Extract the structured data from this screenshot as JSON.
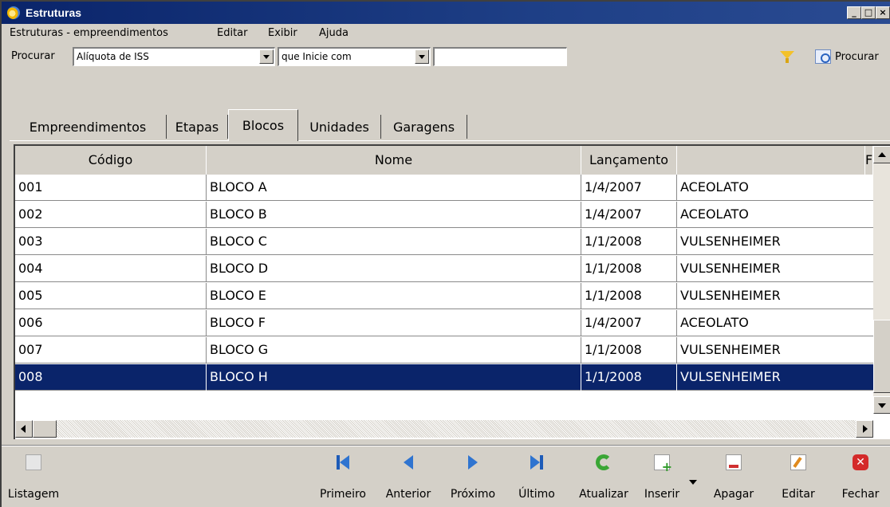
{
  "window": {
    "title": "Estruturas",
    "controls": [
      "_",
      "□",
      "×"
    ]
  },
  "menu": {
    "items": [
      "Estruturas - empreendimentos",
      "Editar",
      "Exibir",
      "Ajuda"
    ]
  },
  "search": {
    "label": "Procurar",
    "field_value": "Alíquota de ISS",
    "operator_value": "que Inicie com",
    "text_value": "",
    "button_label": "Procurar"
  },
  "tabs": [
    {
      "label": "Empreendimentos",
      "active": false
    },
    {
      "label": "Etapas",
      "active": false
    },
    {
      "label": "Blocos",
      "active": true
    },
    {
      "label": "Unidades",
      "active": false
    },
    {
      "label": "Garagens",
      "active": false
    }
  ],
  "grid": {
    "columns": [
      "Código",
      "Nome",
      "Lançamento",
      "",
      "F"
    ],
    "rows": [
      [
        "001",
        "BLOCO A",
        "1/4/2007",
        "ACEOLATO"
      ],
      [
        "002",
        "BLOCO B",
        "1/4/2007",
        "ACEOLATO"
      ],
      [
        "003",
        "BLOCO C",
        "1/1/2008",
        "VULSENHEIMER"
      ],
      [
        "004",
        "BLOCO D",
        "1/1/2008",
        "VULSENHEIMER"
      ],
      [
        "005",
        "BLOCO E",
        "1/1/2008",
        "VULSENHEIMER"
      ],
      [
        "006",
        "BLOCO F",
        "1/4/2007",
        "ACEOLATO"
      ],
      [
        "007",
        "BLOCO G",
        "1/1/2008",
        "VULSENHEIMER"
      ],
      [
        "008",
        "BLOCO H",
        "1/1/2008",
        "VULSENHEIMER"
      ]
    ],
    "selected_row": 7
  },
  "toolbar": {
    "listagem": "Listagem",
    "primeiro": "Primeiro",
    "anterior": "Anterior",
    "proximo": "Próximo",
    "ultimo": "Último",
    "atualizar": "Atualizar",
    "inserir": "Inserir",
    "apagar": "Apagar",
    "editar": "Editar",
    "fechar": "Fechar"
  },
  "colors": {
    "titlebar": "#0a246a",
    "selection": "#0a246a",
    "face": "#d4d0c8"
  }
}
